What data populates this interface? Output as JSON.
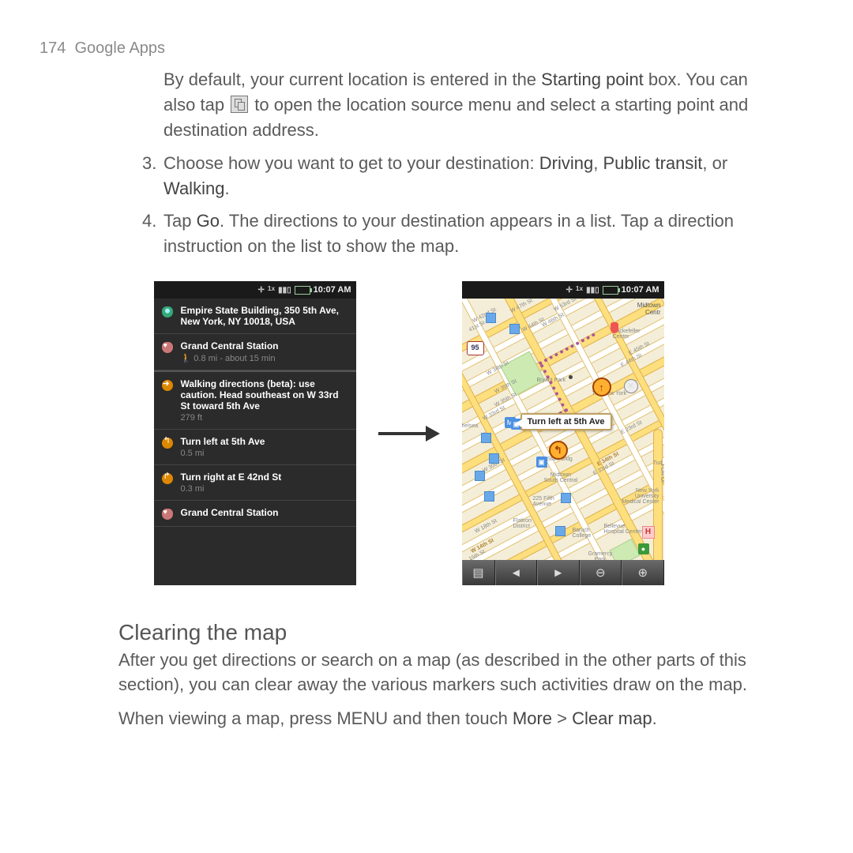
{
  "header": {
    "page": "174",
    "section": "Google Apps"
  },
  "para1_a": "By default, your current location is entered in the ",
  "para1_b": "Starting point",
  "para1_c": " box. You can also tap ",
  "para1_d": " to open the location source menu and select a starting point and destination address.",
  "steps": [
    {
      "num": "3.",
      "parts": [
        "Choose how you want to get to your destination: ",
        "Driving",
        ", ",
        "Public transit",
        ", or ",
        "Walking",
        "."
      ]
    },
    {
      "num": "4.",
      "parts": [
        "Tap ",
        "Go",
        ". The directions to your destination appears in a list. Tap a direction instruction on the list to show the map."
      ]
    }
  ],
  "statusbar_time": "10:07 AM",
  "directions": {
    "start_title": "Empire State Building, 350 5th Ave, New York, NY 10018, USA",
    "end_title": "Grand Central Station",
    "end_sub": "0.8 mi - about 15 min",
    "steps": [
      {
        "title": "Walking directions (beta): use caution. Head southeast on W 33rd St toward 5th Ave",
        "sub": "279 ft",
        "icon": "walk"
      },
      {
        "title": "Turn left at 5th Ave",
        "sub": "0.5 mi",
        "icon": "turn-l"
      },
      {
        "title": "Turn right at E 42nd St",
        "sub": "0.3 mi",
        "icon": "turn-r"
      }
    ],
    "final": "Grand Central Station"
  },
  "map": {
    "callout": "Turn left at 5th Ave",
    "shield": "95",
    "hospital_badge": "H",
    "labels": {
      "midtown": "Midtown\nCentr",
      "rock": "Rockefeller\nCenter",
      "bryant": "Bryant Park",
      "nypl": "The New York",
      "chelsea": "helsea",
      "state": "State Bldg",
      "midsouth": "Midtown\nSouth Central",
      "fifth": "225 Fifth\nAvenue",
      "nyu": "New York\nUniversity\nMedical Center",
      "flatiron": "Flatiron\nDistrict",
      "baruch": "Baruch\nCollege",
      "bellevue": "Bellevue\nHospital Center",
      "gramercy": "Gramercy\nPark",
      "tud": "Tud",
      "fdr": "FDR Dr",
      "e34": "E 34th St",
      "e33": "E 33rd St",
      "e44": "E 44th St",
      "e45": "E 45th St",
      "e23": "E 23rd St",
      "w42": "W 42nd St",
      "w41": "41st St",
      "w47": "W 47th St",
      "w53": "W 53rd St",
      "w44": "W 44th St",
      "w46": "W 46th St",
      "w33": "W 33rd St",
      "w30": "W 30th St",
      "w35": "W 35th St",
      "w38": "W 38th St",
      "w36": "W 36th St",
      "w18": "W 18th St",
      "w14": "W 14th St",
      "w15": "15th St"
    }
  },
  "clearing": {
    "heading": "Clearing the map",
    "body": "After you get directions or search on a map (as described in the other parts of this section), you can clear away the various markers such activities draw on the map.",
    "instr_a": "When viewing a map, press MENU and then touch ",
    "instr_b": "More",
    "instr_c": " > ",
    "instr_d": "Clear map",
    "instr_e": "."
  }
}
